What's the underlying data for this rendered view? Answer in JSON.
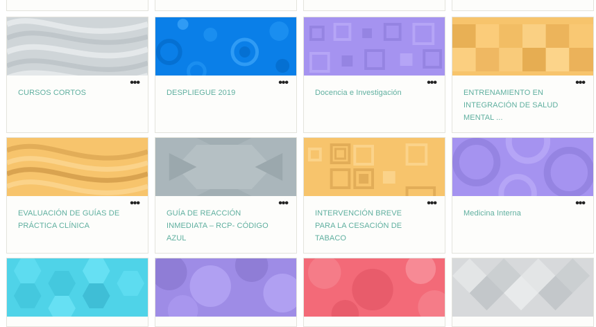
{
  "courses": [
    {
      "title": "CURSOS CORTOS",
      "menu": "•••",
      "pattern": "waves-gray"
    },
    {
      "title": "DESPLIEGUE 2019",
      "menu": "•••",
      "pattern": "circles-blue"
    },
    {
      "title": "Docencia e Investigación",
      "menu": "•••",
      "pattern": "squares-purple"
    },
    {
      "title": "ENTRENAMIENTO EN INTEGRACIÓN DE SALUD MENTAL ...",
      "menu": "•••",
      "pattern": "tiles-orange"
    },
    {
      "title": "EVALUACIÓN DE GUÍAS DE PRÁCTICA CLÍNICA",
      "menu": "•••",
      "pattern": "waves-orange"
    },
    {
      "title": "GUÍA DE REACCIÓN INMEDIATA – RCP- CÓDIGO AZUL",
      "menu": "•••",
      "pattern": "hexagon-gray"
    },
    {
      "title": "INTERVENCIÓN BREVE PARA LA CESACIÓN DE TABACO",
      "menu": "•••",
      "pattern": "squares-orange"
    },
    {
      "title": "Medicina Interna",
      "menu": "•••",
      "pattern": "rings-purple"
    }
  ],
  "bottom_row_patterns": [
    "hexagons-cyan",
    "bubbles-purple",
    "bubbles-red",
    "diamonds-gray"
  ],
  "colors": {
    "title": "#5faf9f",
    "card_bg": "#fdfdfb",
    "border": "#e3e3dc",
    "gray": "#cfd5d8",
    "blue": "#0a7fe8",
    "purple": "#a593f0",
    "orange": "#f7c46c",
    "slate": "#aab6bb",
    "cyan": "#4fd3e8",
    "red": "#f36a78",
    "lightgray": "#d7d9db"
  }
}
